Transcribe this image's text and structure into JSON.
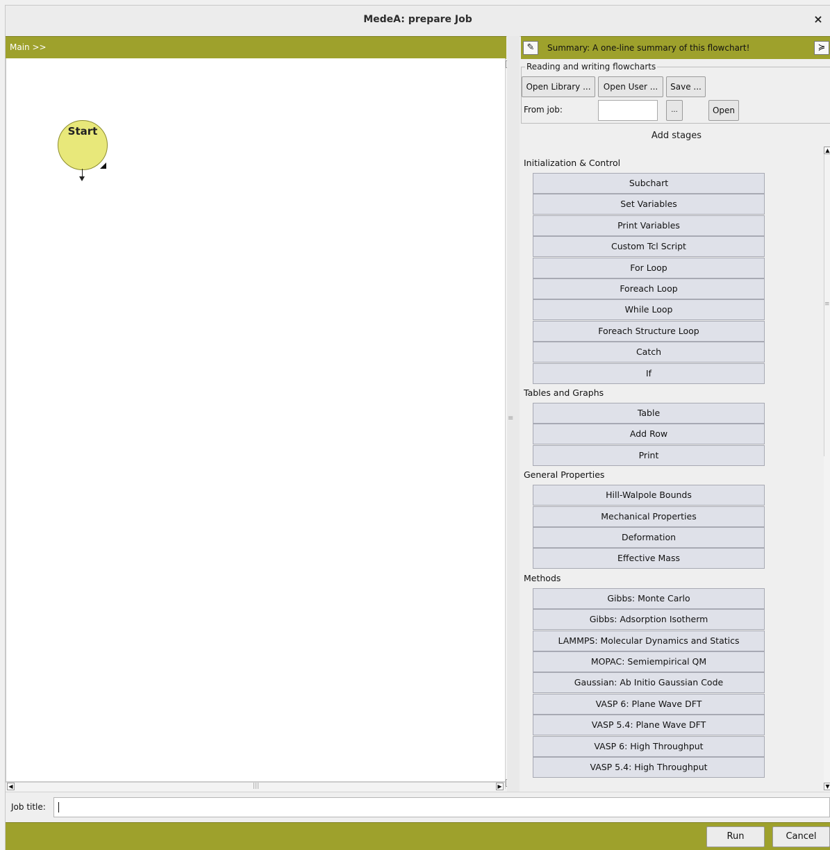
{
  "window": {
    "title": "MedeA: prepare Job",
    "close_glyph": "×"
  },
  "breadcrumb": "Main >>",
  "flowchart": {
    "start_label": "Start"
  },
  "summary": {
    "text": "Summary: A one-line summary of this flowchart!",
    "edit_icon": "pencil-icon",
    "collapse_icon": "double-chevron-down-icon",
    "pencil_glyph": "✎",
    "collapse_glyph": "≽"
  },
  "reading_writing": {
    "legend": "Reading and writing flowcharts",
    "open_library": "Open Library ...",
    "open_user": "Open User ...",
    "save": "Save ...",
    "from_job_label": "From job:",
    "from_job_value": "",
    "browse": "...",
    "open": "Open"
  },
  "add_stages_title": "Add stages",
  "sections": [
    {
      "title": "Initialization & Control",
      "items": [
        "Subchart",
        "Set Variables",
        "Print Variables",
        "Custom Tcl Script",
        "For Loop",
        "Foreach Loop",
        "While Loop",
        "Foreach Structure Loop",
        "Catch",
        "If"
      ]
    },
    {
      "title": "Tables and Graphs",
      "items": [
        "Table",
        "Add Row",
        "Print"
      ]
    },
    {
      "title": "General Properties",
      "items": [
        "Hill-Walpole Bounds",
        "Mechanical Properties",
        "Deformation",
        "Effective Mass"
      ]
    },
    {
      "title": "Methods",
      "items": [
        "Gibbs: Monte Carlo",
        "Gibbs: Adsorption Isotherm",
        "LAMMPS: Molecular Dynamics and Statics",
        "MOPAC: Semiempirical QM",
        "Gaussian: Ab Initio Gaussian Code",
        "VASP 6: Plane Wave DFT",
        "VASP 5.4: Plane Wave DFT",
        "VASP 6: High Throughput",
        "VASP 5.4: High Throughput"
      ]
    }
  ],
  "job": {
    "label": "Job title:",
    "value": ""
  },
  "footer": {
    "run": "Run",
    "cancel": "Cancel"
  },
  "colors": {
    "olive": "#9ea12c",
    "start_fill": "#e8e87a",
    "stage_button": "#dfe1e9"
  }
}
